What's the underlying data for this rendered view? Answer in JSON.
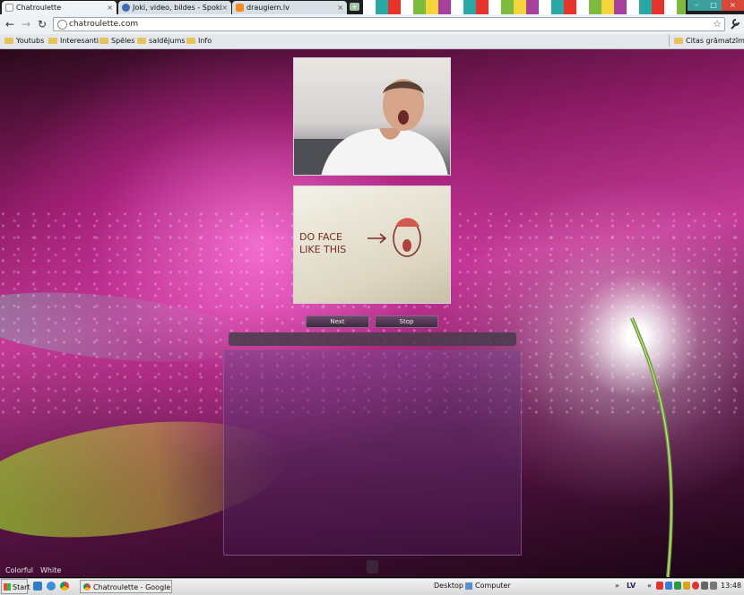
{
  "browser": {
    "tabs": [
      {
        "label": "Chatroulette",
        "icon": "page-icon",
        "active": true
      },
      {
        "label": "Joki, video, bildes - Spoki",
        "icon": "spoki-icon",
        "active": false
      },
      {
        "label": "draugiem.lv",
        "icon": "draugiem-icon",
        "active": false
      }
    ],
    "tab_close": "×",
    "new_tab": "+",
    "window_buttons": {
      "minimize": "–",
      "maximize": "□",
      "close": "×"
    },
    "nav": {
      "back": "←",
      "forward": "→",
      "reload": "↻",
      "menu": "wrench-icon"
    },
    "address": "chatroulette.com",
    "bookmark_star": "☆",
    "bookmarks": [
      "Youtubs",
      "Interesanti",
      "Spēles",
      "saldējums",
      "Info"
    ],
    "other_bookmarks": "Citas grāmatzīmes"
  },
  "page": {
    "partner_video_icon": "person-webcam-image",
    "self_video_sign": [
      "DO FACE",
      "LIKE THIS"
    ],
    "next_label": "Next",
    "stop_label": "Stop",
    "theme_links": [
      "Colorful",
      "White"
    ],
    "colors": {
      "accent": "#c43b97",
      "panel": "#3e2940"
    }
  },
  "taskbar": {
    "start_label": "Start",
    "task": "Chatroulette - Google C...",
    "desktop": "Desktop",
    "computer": "Computer",
    "chevron": "»",
    "lang": "LV",
    "tray_arrow": "«",
    "clock": "13:48"
  }
}
